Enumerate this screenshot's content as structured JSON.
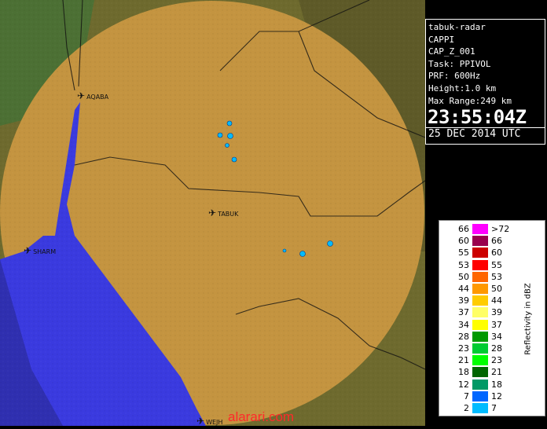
{
  "info": {
    "lines": [
      "tabuk-radar",
      "CAPPI",
      "CAP_Z_001",
      "Task: PPIVOL",
      "PRF: 600Hz",
      "Height:1.0 km",
      "Max Range:249 km"
    ],
    "time": "23:55:04Z",
    "date": "25 DEC 2014 UTC"
  },
  "places": [
    {
      "name": "AQABA"
    },
    {
      "name": "TABUK"
    },
    {
      "name": "SHARM"
    },
    {
      "name": "WEJH"
    }
  ],
  "legend": {
    "title": "Reflectivity in dBZ",
    "rows": [
      {
        "lo": "66",
        "hi": ">72",
        "color": "#ff00ff"
      },
      {
        "lo": "60",
        "hi": "66",
        "color": "#99004d"
      },
      {
        "lo": "55",
        "hi": "60",
        "color": "#cc0000"
      },
      {
        "lo": "53",
        "hi": "55",
        "color": "#ff0000"
      },
      {
        "lo": "50",
        "hi": "53",
        "color": "#ff6600"
      },
      {
        "lo": "44",
        "hi": "50",
        "color": "#ff9900"
      },
      {
        "lo": "39",
        "hi": "44",
        "color": "#ffcc00"
      },
      {
        "lo": "37",
        "hi": "39",
        "color": "#ffff66"
      },
      {
        "lo": "34",
        "hi": "37",
        "color": "#ffff00"
      },
      {
        "lo": "28",
        "hi": "34",
        "color": "#009900"
      },
      {
        "lo": "23",
        "hi": "28",
        "color": "#00cc33"
      },
      {
        "lo": "21",
        "hi": "23",
        "color": "#00ff00"
      },
      {
        "lo": "18",
        "hi": "21",
        "color": "#006600"
      },
      {
        "lo": "12",
        "hi": "18",
        "color": "#009966"
      },
      {
        "lo": "7",
        "hi": "12",
        "color": "#0066ff"
      },
      {
        "lo": "2",
        "hi": "7",
        "color": "#00bbff"
      }
    ]
  },
  "watermark": "alarari.com"
}
